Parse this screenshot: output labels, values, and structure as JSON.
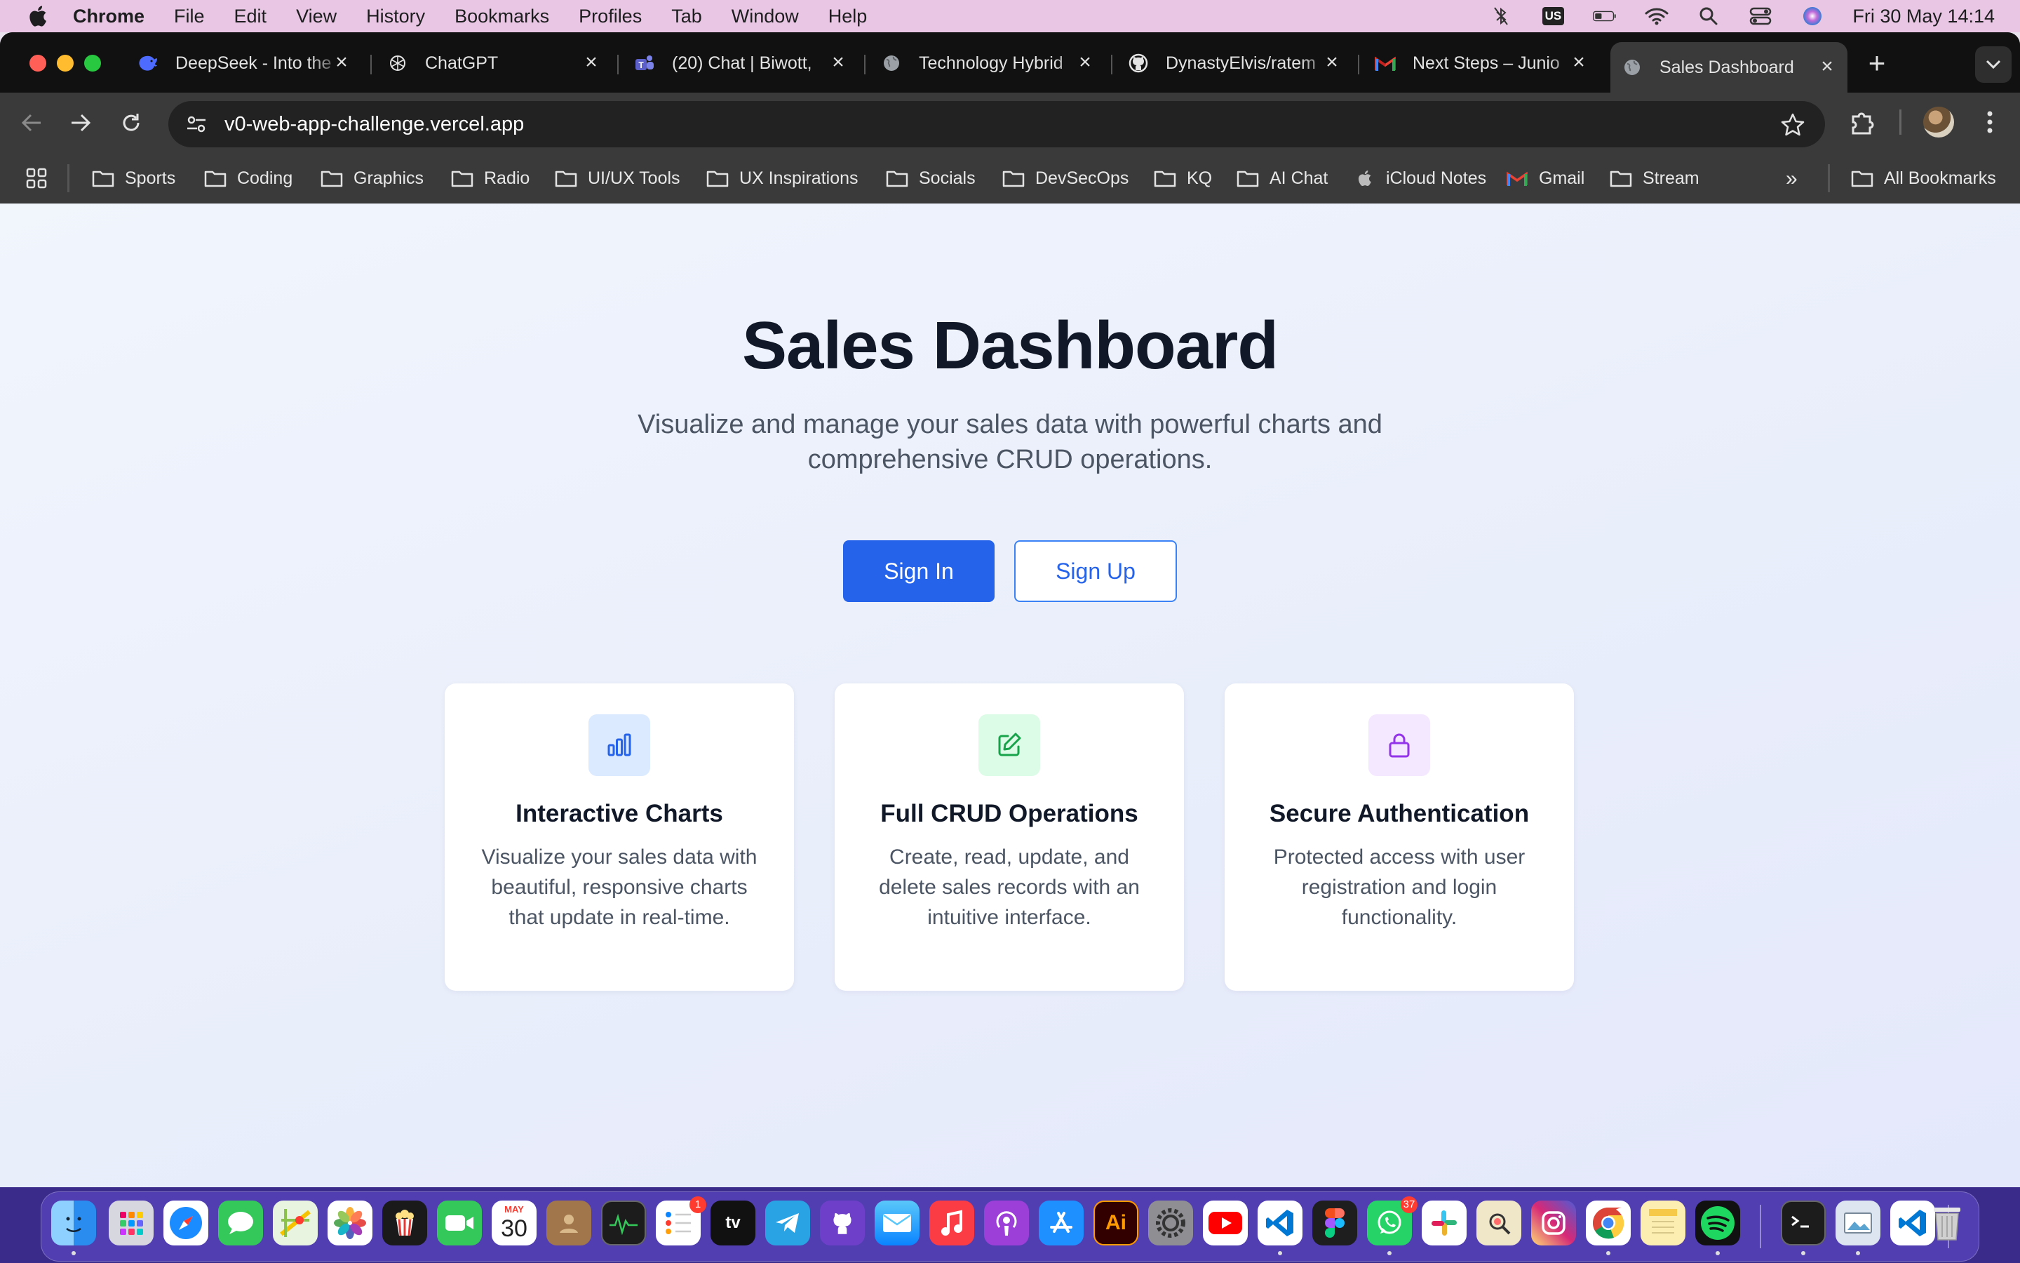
{
  "menubar": {
    "app_name": "Chrome",
    "menus": [
      "File",
      "Edit",
      "View",
      "History",
      "Bookmarks",
      "Profiles",
      "Tab",
      "Window",
      "Help"
    ],
    "keyboard_layout": "US",
    "clock": "Fri 30 May  14:14"
  },
  "tabs": [
    {
      "title": "DeepSeek - Into the",
      "icon": "deepseek-icon"
    },
    {
      "title": "ChatGPT",
      "icon": "chatgpt-icon"
    },
    {
      "title": "(20) Chat | Biwott,",
      "icon": "teams-icon"
    },
    {
      "title": "Technology Hybrid",
      "icon": "globe-icon"
    },
    {
      "title": "DynastyElvis/ratem",
      "icon": "github-icon"
    },
    {
      "title": "Next Steps – Junio",
      "icon": "gmail-icon"
    },
    {
      "title": "Sales Dashboard",
      "icon": "globe-icon",
      "active": true
    }
  ],
  "omnibox": {
    "url": "v0-web-app-challenge.vercel.app"
  },
  "bookmarks": [
    {
      "label": "Sports",
      "icon": "folder-icon"
    },
    {
      "label": "Coding",
      "icon": "folder-icon"
    },
    {
      "label": "Graphics",
      "icon": "folder-icon"
    },
    {
      "label": "Radio",
      "icon": "folder-icon"
    },
    {
      "label": "UI/UX Tools",
      "icon": "folder-icon"
    },
    {
      "label": "UX Inspirations",
      "icon": "folder-icon"
    },
    {
      "label": "Socials",
      "icon": "folder-icon"
    },
    {
      "label": "DevSecOps",
      "icon": "folder-icon"
    },
    {
      "label": "KQ",
      "icon": "folder-icon"
    },
    {
      "label": "AI Chat",
      "icon": "folder-icon"
    },
    {
      "label": "iCloud Notes",
      "icon": "apple-icon"
    },
    {
      "label": "Gmail",
      "icon": "gmail-icon"
    },
    {
      "label": "Stream",
      "icon": "folder-icon"
    }
  ],
  "bookmarks_all": "All Bookmarks",
  "hero": {
    "title": "Sales Dashboard",
    "subtitle": "Visualize and manage your sales data with powerful charts and comprehensive CRUD operations.",
    "sign_in": "Sign In",
    "sign_up": "Sign Up"
  },
  "features": [
    {
      "title": "Interactive Charts",
      "description": "Visualize your sales data with beautiful, responsive charts that update in real-time.",
      "icon": "bar-chart-icon",
      "accent": "#2563eb",
      "bg": "#dbeafe"
    },
    {
      "title": "Full CRUD Operations",
      "description": "Create, read, update, and delete sales records with an intuitive interface.",
      "icon": "edit-icon",
      "accent": "#16a34a",
      "bg": "#dcfce7"
    },
    {
      "title": "Secure Authentication",
      "description": "Protected access with user registration and login functionality.",
      "icon": "lock-icon",
      "accent": "#9333ea",
      "bg": "#f3e8ff"
    }
  ],
  "dock": {
    "calendar_month": "MAY",
    "calendar_day": "30",
    "reminders_badge": "1",
    "whatsapp_badge": "37"
  },
  "colors": {
    "primary": "#2563eb",
    "menubar": "#e9c7e4",
    "dock": "#5a46be"
  }
}
